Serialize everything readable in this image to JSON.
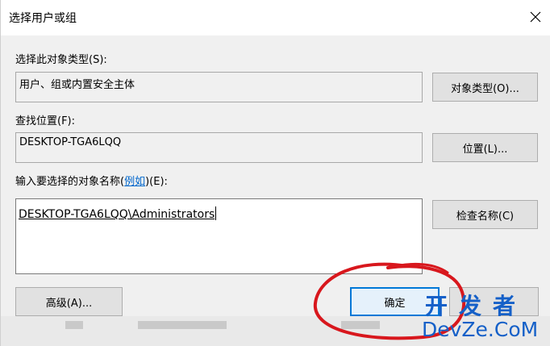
{
  "window": {
    "title": "选择用户或组"
  },
  "object_type": {
    "label": "选择此对象类型(S):",
    "value": "用户、组或内置安全主体",
    "button": "对象类型(O)..."
  },
  "location": {
    "label": "查找位置(F):",
    "value": "DESKTOP-TGA6LQQ",
    "button": "位置(L)..."
  },
  "names": {
    "label_prefix": "输入要选择的对象名称(",
    "label_link": "例如",
    "label_suffix": ")(E):",
    "value": "DESKTOP-TGA6LQQ\\Administrators",
    "check_button": "检查名称(C)"
  },
  "footer": {
    "advanced_button": "高级(A)...",
    "ok_button": "确定"
  },
  "watermark": {
    "cn": "开发者",
    "en": "DevZe.CoM"
  },
  "colors": {
    "annotation": "#d8171d",
    "watermark": "#1560c8",
    "focus_border": "#0078d7",
    "link": "#0066cc"
  },
  "icons": {
    "close": "close-icon"
  }
}
